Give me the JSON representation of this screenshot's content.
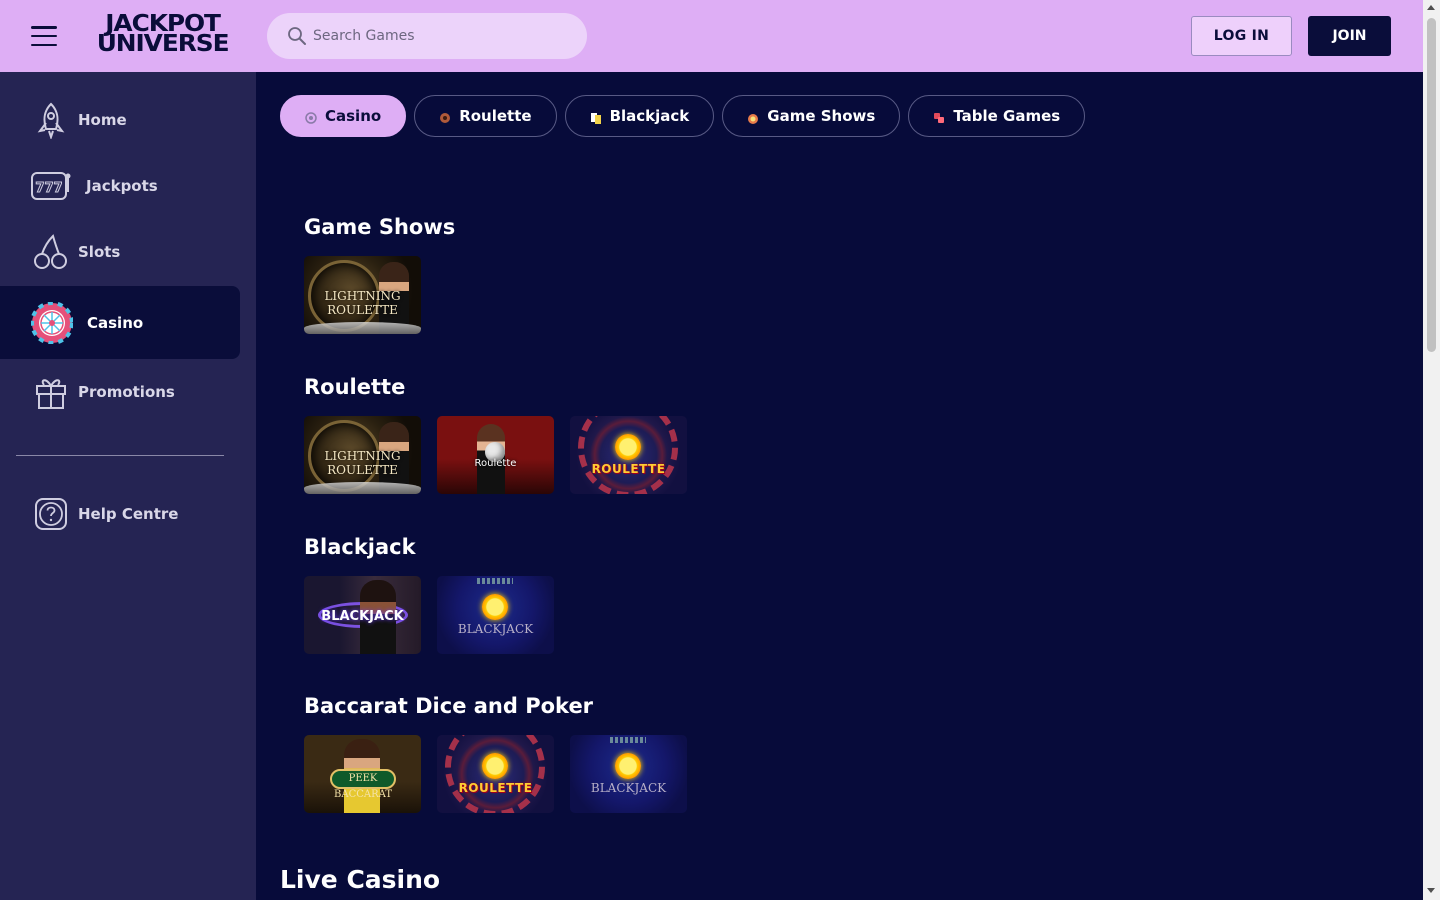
{
  "header": {
    "brand_line1": "JACKPOT",
    "brand_line2": "UNIVERSE",
    "search_placeholder": "Search Games",
    "login_label": "LOG IN",
    "join_label": "JOIN"
  },
  "sidebar": {
    "items": [
      {
        "label": "Home",
        "icon": "rocket-icon"
      },
      {
        "label": "Jackpots",
        "icon": "slot-machine-icon"
      },
      {
        "label": "Slots",
        "icon": "cherries-icon"
      },
      {
        "label": "Casino",
        "icon": "roulette-wheel-icon",
        "active": true
      },
      {
        "label": "Promotions",
        "icon": "gift-icon"
      }
    ],
    "help_label": "Help Centre"
  },
  "tabs": [
    {
      "label": "Casino",
      "active": true
    },
    {
      "label": "Roulette"
    },
    {
      "label": "Blackjack"
    },
    {
      "label": "Game Shows"
    },
    {
      "label": "Table Games"
    }
  ],
  "sections": [
    {
      "title": "Game Shows",
      "games": [
        {
          "caption": "LIGHTNING ROULETTE"
        }
      ]
    },
    {
      "title": "Roulette",
      "games": [
        {
          "caption": "LIGHTNING ROULETTE"
        },
        {
          "caption": "Roulette"
        },
        {
          "caption": "ROULETTE"
        }
      ]
    },
    {
      "title": "Blackjack",
      "games": [
        {
          "caption": "BLACKJACK"
        },
        {
          "caption": "BLACKJACK"
        }
      ]
    },
    {
      "title": "Baccarat Dice and Poker",
      "games": [
        {
          "caption": "PEEK BACCARAT"
        },
        {
          "caption": "ROULETTE"
        },
        {
          "caption": "BLACKJACK"
        }
      ]
    }
  ],
  "live_casino_title": "Live Casino",
  "colors": {
    "header_bg": "#deaef5",
    "sidebar_bg": "#252453",
    "main_bg": "#070b3a",
    "active_chip": "#deaef5"
  }
}
